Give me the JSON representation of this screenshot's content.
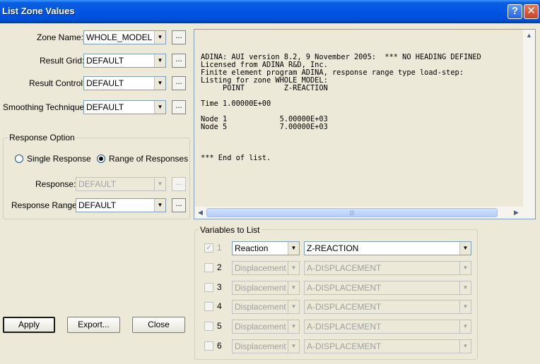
{
  "window": {
    "title": "List Zone Values",
    "help_glyph": "?",
    "close_glyph": "✕"
  },
  "form": {
    "zone_name_label": "Zone Name:",
    "zone_name_value": "WHOLE_MODEL",
    "result_grid_label": "Result Grid:",
    "result_grid_value": "DEFAULT",
    "result_control_label": "Result Control:",
    "result_control_value": "DEFAULT",
    "smoothing_label": "Smoothing Technique:",
    "smoothing_value": "DEFAULT",
    "browse_glyph": "..."
  },
  "response_option": {
    "group_label": "Response Option",
    "single_label": "Single Response",
    "single_selected": false,
    "range_label": "Range of Responses",
    "range_selected": true,
    "response_label": "Response:",
    "response_value": "DEFAULT",
    "response_range_label": "Response Range:",
    "response_range_value": "DEFAULT"
  },
  "buttons": {
    "apply": "Apply",
    "export": "Export...",
    "close": "Close"
  },
  "listing": {
    "text": "ADINA: AUI version 8.2, 9 November 2005:  *** NO HEADING DEFINED\nLicensed from ADINA R&D, Inc.\nFinite element program ADINA, response range type load-step:\nListing for zone WHOLE_MODEL:\n     POINT         Z-REACTION\n\nTime 1.00000E+00\n\nNode 1            5.00000E+03\nNode 5            7.00000E+03\n\n\n\n*** End of list."
  },
  "variables": {
    "group_label": "Variables to List",
    "rows": [
      {
        "num": "1",
        "checked": true,
        "enabled": true,
        "type": "Reaction",
        "component": "Z-REACTION"
      },
      {
        "num": "2",
        "checked": false,
        "enabled": false,
        "type": "Displacement",
        "component": "A-DISPLACEMENT"
      },
      {
        "num": "3",
        "checked": false,
        "enabled": false,
        "type": "Displacement",
        "component": "A-DISPLACEMENT"
      },
      {
        "num": "4",
        "checked": false,
        "enabled": false,
        "type": "Displacement",
        "component": "A-DISPLACEMENT"
      },
      {
        "num": "5",
        "checked": false,
        "enabled": false,
        "type": "Displacement",
        "component": "A-DISPLACEMENT"
      },
      {
        "num": "6",
        "checked": false,
        "enabled": false,
        "type": "Displacement",
        "component": "A-DISPLACEMENT"
      }
    ]
  },
  "icons": {
    "dropdown": "chevron-down-icon",
    "check": "checkmark-icon",
    "scroll_up": "arrow-up-icon",
    "scroll_left": "arrow-left-icon",
    "scroll_right": "arrow-right-icon"
  },
  "colors": {
    "titlebar": "#0055e5",
    "window_bg": "#ece9d8",
    "field_border": "#7f9db9",
    "disabled_text": "#a0a0a0"
  }
}
